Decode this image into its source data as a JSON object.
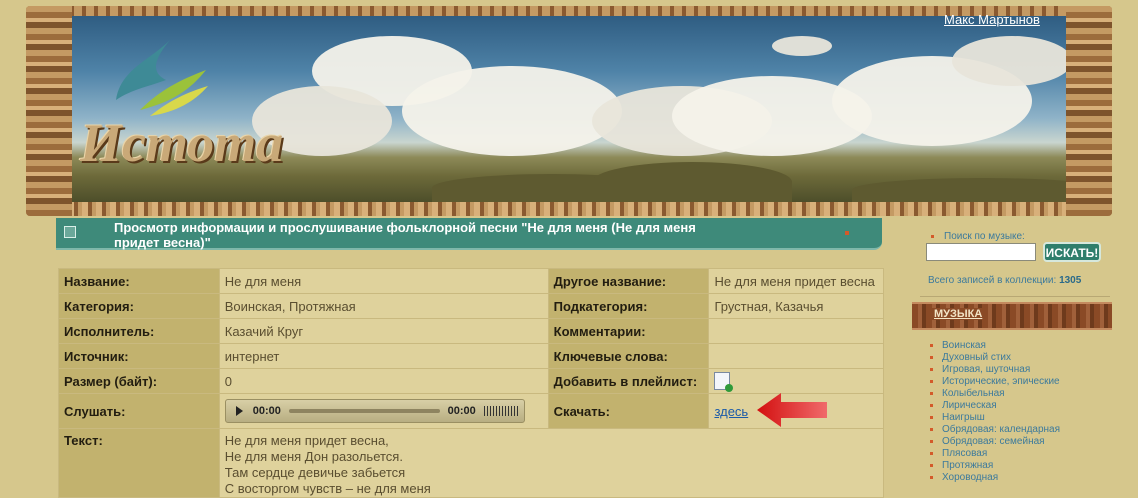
{
  "header": {
    "logo_text": "Истоmа",
    "user_name": "Макс Мартынов"
  },
  "title_bar": {
    "text": "Просмотр информации и прослушивание фольклорной песни \"Не для меня (Не для меня придет весна)\""
  },
  "song_info": {
    "name_label": "Название:",
    "name_value": "Не для меня",
    "other_name_label": "Другое название:",
    "other_name_value": "Не для меня придет весна",
    "category_label": "Категория:",
    "category_value": "Воинская, Протяжная",
    "subcategory_label": "Подкатегория:",
    "subcategory_value": "Грустная, Казачья",
    "performer_label": "Исполнитель:",
    "performer_value": "Казачий Круг",
    "comments_label": "Комментарии:",
    "comments_value": "",
    "source_label": "Источник:",
    "source_value": "интернет",
    "keywords_label": "Ключевые слова:",
    "keywords_value": "",
    "size_label": "Размер (байт):",
    "size_value": "0",
    "playlist_label": "Добавить в плейлист:",
    "listen_label": "Слушать:",
    "player_current_time": "00:00",
    "player_total_time": "00:00",
    "download_label": "Скачать:",
    "download_link": "здесь",
    "text_label": "Текст:",
    "lyrics": [
      "Не для меня придет весна,",
      "Не для меня Дон разольется.",
      "Там сердце девичье забьется",
      "С восторгом чувств – не для меня"
    ]
  },
  "sidebar": {
    "search_label": "Поиск по музыке:",
    "search_value": "",
    "search_button": "ИСКАТЬ!",
    "total_label": "Всего записей в коллекции:",
    "total_count": "1305",
    "music_heading": "МУЗЫКА",
    "genres": [
      "Воинская",
      "Духовный стих",
      "Игровая, шуточная",
      "Исторические, эпические",
      "Колыбельная",
      "Лирическая",
      "Наигрыш",
      "Обрядовая: календарная",
      "Обрядовая: семейная",
      "Плясовая",
      "Протяжная",
      "Хороводная"
    ]
  },
  "colors": {
    "page_background": "#d6c78c",
    "title_bar": "#3e8a7a",
    "label_cell": "#c2b26e",
    "value_cell": "#dfd29c",
    "link": "#1a5aa8",
    "arrow": "#cc1111"
  }
}
